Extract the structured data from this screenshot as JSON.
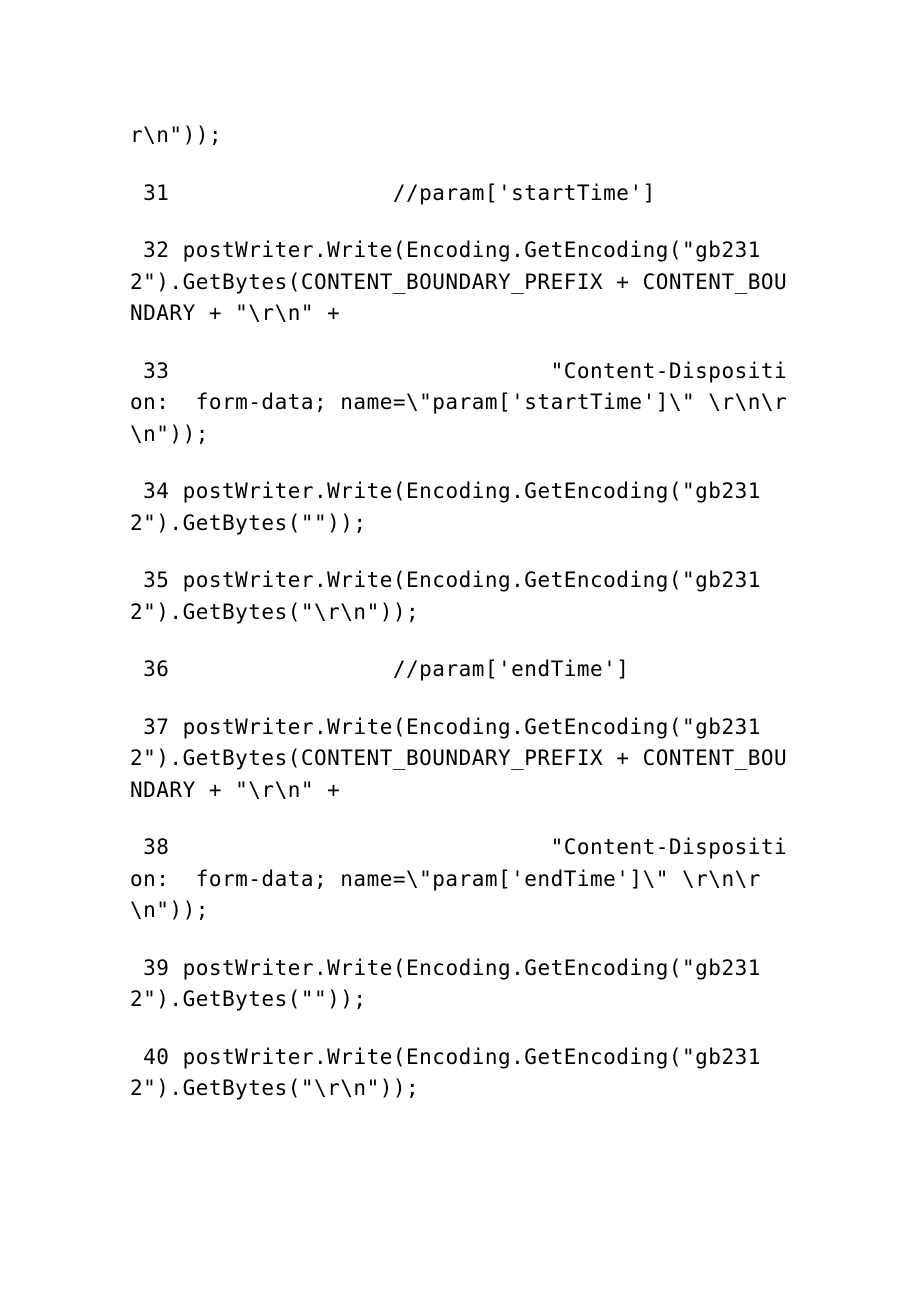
{
  "lines": [
    {
      "text": "r\\n\"));"
    },
    {
      "text": " 31                 //param['startTime']"
    },
    {
      "text": " 32 postWriter.Write(Encoding.GetEncoding(\"gb2312\").GetBytes(CONTENT_BOUNDARY_PREFIX + CONTENT_BOUNDARY + \"\\r\\n\" +"
    },
    {
      "text": " 33                             \"Content-Disposition:  form-data; name=\\\"param['startTime']\\\" \\r\\n\\r\\n\"));"
    },
    {
      "text": " 34 postWriter.Write(Encoding.GetEncoding(\"gb2312\").GetBytes(\"\"));"
    },
    {
      "text": " 35 postWriter.Write(Encoding.GetEncoding(\"gb2312\").GetBytes(\"\\r\\n\"));"
    },
    {
      "text": " 36                 //param['endTime']"
    },
    {
      "text": " 37 postWriter.Write(Encoding.GetEncoding(\"gb2312\").GetBytes(CONTENT_BOUNDARY_PREFIX + CONTENT_BOUNDARY + \"\\r\\n\" +"
    },
    {
      "text": " 38                             \"Content-Disposition:  form-data; name=\\\"param['endTime']\\\" \\r\\n\\r\\n\"));"
    },
    {
      "text": " 39 postWriter.Write(Encoding.GetEncoding(\"gb2312\").GetBytes(\"\"));"
    },
    {
      "text": " 40 postWriter.Write(Encoding.GetEncoding(\"gb2312\").GetBytes(\"\\r\\n\"));"
    }
  ]
}
